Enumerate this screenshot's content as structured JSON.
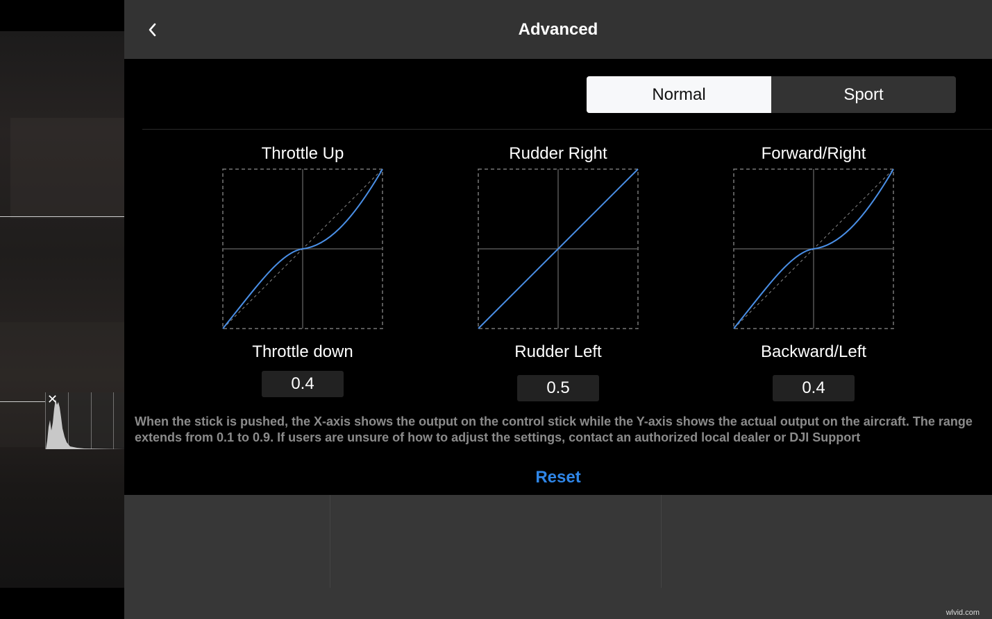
{
  "header": {
    "title": "Advanced",
    "back_icon": "chevron-left-icon"
  },
  "modes": {
    "options": [
      "Normal",
      "Sport"
    ],
    "selected": "Normal"
  },
  "curves": [
    {
      "top_label": "Throttle Up",
      "bottom_label": "Throttle down",
      "value": "0.4"
    },
    {
      "top_label": "Rudder Right",
      "bottom_label": "Rudder Left",
      "value": "0.5"
    },
    {
      "top_label": "Forward/Right",
      "bottom_label": "Backward/Left",
      "value": "0.4"
    }
  ],
  "note": "When the stick is pushed, the X-axis shows the output on the control stick while the Y-axis shows the actual output on the aircraft. The range extends from 0.1 to 0.9. If users are unsure of how to adjust the settings, contact an authorized local dealer or DJI Support",
  "reset_label": "Reset",
  "histogram": {
    "close_icon": "close-icon"
  },
  "watermark": "wlvid.com",
  "colors": {
    "accent": "#2f86e8",
    "curve": "#4a8fe6",
    "selected_bg": "#f7f8fa"
  }
}
